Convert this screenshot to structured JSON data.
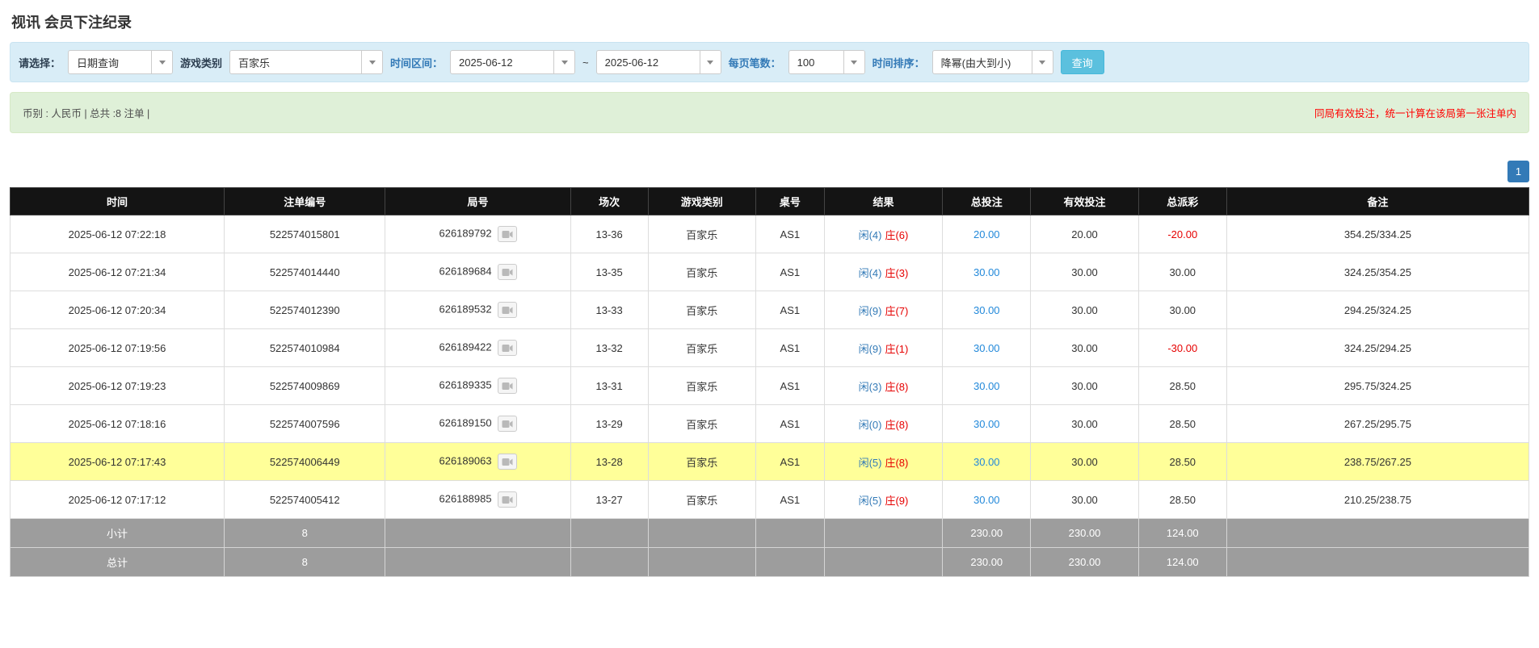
{
  "page": {
    "title": "视讯 会员下注纪录"
  },
  "filters": {
    "select_label": "请选择：",
    "select_value": "日期查询",
    "game_type_label": "游戏类别",
    "game_type_value": "百家乐",
    "date_range_label": "时间区间：",
    "date_from": "2025-06-12",
    "date_separator": "~",
    "date_to": "2025-06-12",
    "page_size_label": "每页笔数：",
    "page_size_value": "100",
    "sort_label": "时间排序：",
    "sort_value": "降幂(由大到小)",
    "search_button": "查询"
  },
  "summary_bar": {
    "left": "币别 : 人民币 | 总共 :8 注单 |",
    "right": "同局有效投注，统一计算在该局第一张注单内"
  },
  "pagination": {
    "current": "1"
  },
  "icons": {
    "dropdown": "caret-down-icon",
    "round_video": "video-camera-icon"
  },
  "colors": {
    "header_bg": "#141414",
    "footer_bg": "#9d9d9d",
    "highlight_row": "#ffff99",
    "bet_link_blue": "#2389da",
    "player_blue": "#337ab7",
    "banker_red": "#e60000",
    "notice_red": "#ff0000",
    "filter_bar_bg": "#d9edf7",
    "summary_bar_bg": "#dff0d8",
    "query_button_cyan": "#5bc0de",
    "pagination_blue": "#337ab7"
  },
  "table": {
    "headers": [
      "时间",
      "注单编号",
      "局号",
      "场次",
      "游戏类别",
      "桌号",
      "结果",
      "总投注",
      "有效投注",
      "总派彩",
      "备注"
    ],
    "rows": [
      {
        "time": "2025-06-12 07:22:18",
        "bet_id": "522574015801",
        "round_id": "626189792",
        "session": "13-36",
        "game": "百家乐",
        "table_no": "AS1",
        "result_player": "闲(4)",
        "result_banker": "庄(6)",
        "total_bet": "20.00",
        "valid_bet": "20.00",
        "payout": "-20.00",
        "remark": "354.25/334.25",
        "highlight": false
      },
      {
        "time": "2025-06-12 07:21:34",
        "bet_id": "522574014440",
        "round_id": "626189684",
        "session": "13-35",
        "game": "百家乐",
        "table_no": "AS1",
        "result_player": "闲(4)",
        "result_banker": "庄(3)",
        "total_bet": "30.00",
        "valid_bet": "30.00",
        "payout": "30.00",
        "remark": "324.25/354.25",
        "highlight": false
      },
      {
        "time": "2025-06-12 07:20:34",
        "bet_id": "522574012390",
        "round_id": "626189532",
        "session": "13-33",
        "game": "百家乐",
        "table_no": "AS1",
        "result_player": "闲(9)",
        "result_banker": "庄(7)",
        "total_bet": "30.00",
        "valid_bet": "30.00",
        "payout": "30.00",
        "remark": "294.25/324.25",
        "highlight": false
      },
      {
        "time": "2025-06-12 07:19:56",
        "bet_id": "522574010984",
        "round_id": "626189422",
        "session": "13-32",
        "game": "百家乐",
        "table_no": "AS1",
        "result_player": "闲(9)",
        "result_banker": "庄(1)",
        "total_bet": "30.00",
        "valid_bet": "30.00",
        "payout": "-30.00",
        "remark": "324.25/294.25",
        "highlight": false
      },
      {
        "time": "2025-06-12 07:19:23",
        "bet_id": "522574009869",
        "round_id": "626189335",
        "session": "13-31",
        "game": "百家乐",
        "table_no": "AS1",
        "result_player": "闲(3)",
        "result_banker": "庄(8)",
        "total_bet": "30.00",
        "valid_bet": "30.00",
        "payout": "28.50",
        "remark": "295.75/324.25",
        "highlight": false
      },
      {
        "time": "2025-06-12 07:18:16",
        "bet_id": "522574007596",
        "round_id": "626189150",
        "session": "13-29",
        "game": "百家乐",
        "table_no": "AS1",
        "result_player": "闲(0)",
        "result_banker": "庄(8)",
        "total_bet": "30.00",
        "valid_bet": "30.00",
        "payout": "28.50",
        "remark": "267.25/295.75",
        "highlight": false
      },
      {
        "time": "2025-06-12 07:17:43",
        "bet_id": "522574006449",
        "round_id": "626189063",
        "session": "13-28",
        "game": "百家乐",
        "table_no": "AS1",
        "result_player": "闲(5)",
        "result_banker": "庄(8)",
        "total_bet": "30.00",
        "valid_bet": "30.00",
        "payout": "28.50",
        "remark": "238.75/267.25",
        "highlight": true
      },
      {
        "time": "2025-06-12 07:17:12",
        "bet_id": "522574005412",
        "round_id": "626188985",
        "session": "13-27",
        "game": "百家乐",
        "table_no": "AS1",
        "result_player": "闲(5)",
        "result_banker": "庄(9)",
        "total_bet": "30.00",
        "valid_bet": "30.00",
        "payout": "28.50",
        "remark": "210.25/238.75",
        "highlight": false
      }
    ],
    "subtotal": {
      "label": "小计",
      "count": "8",
      "total_bet": "230.00",
      "valid_bet": "230.00",
      "payout": "124.00"
    },
    "total": {
      "label": "总计",
      "count": "8",
      "total_bet": "230.00",
      "valid_bet": "230.00",
      "payout": "124.00"
    }
  }
}
